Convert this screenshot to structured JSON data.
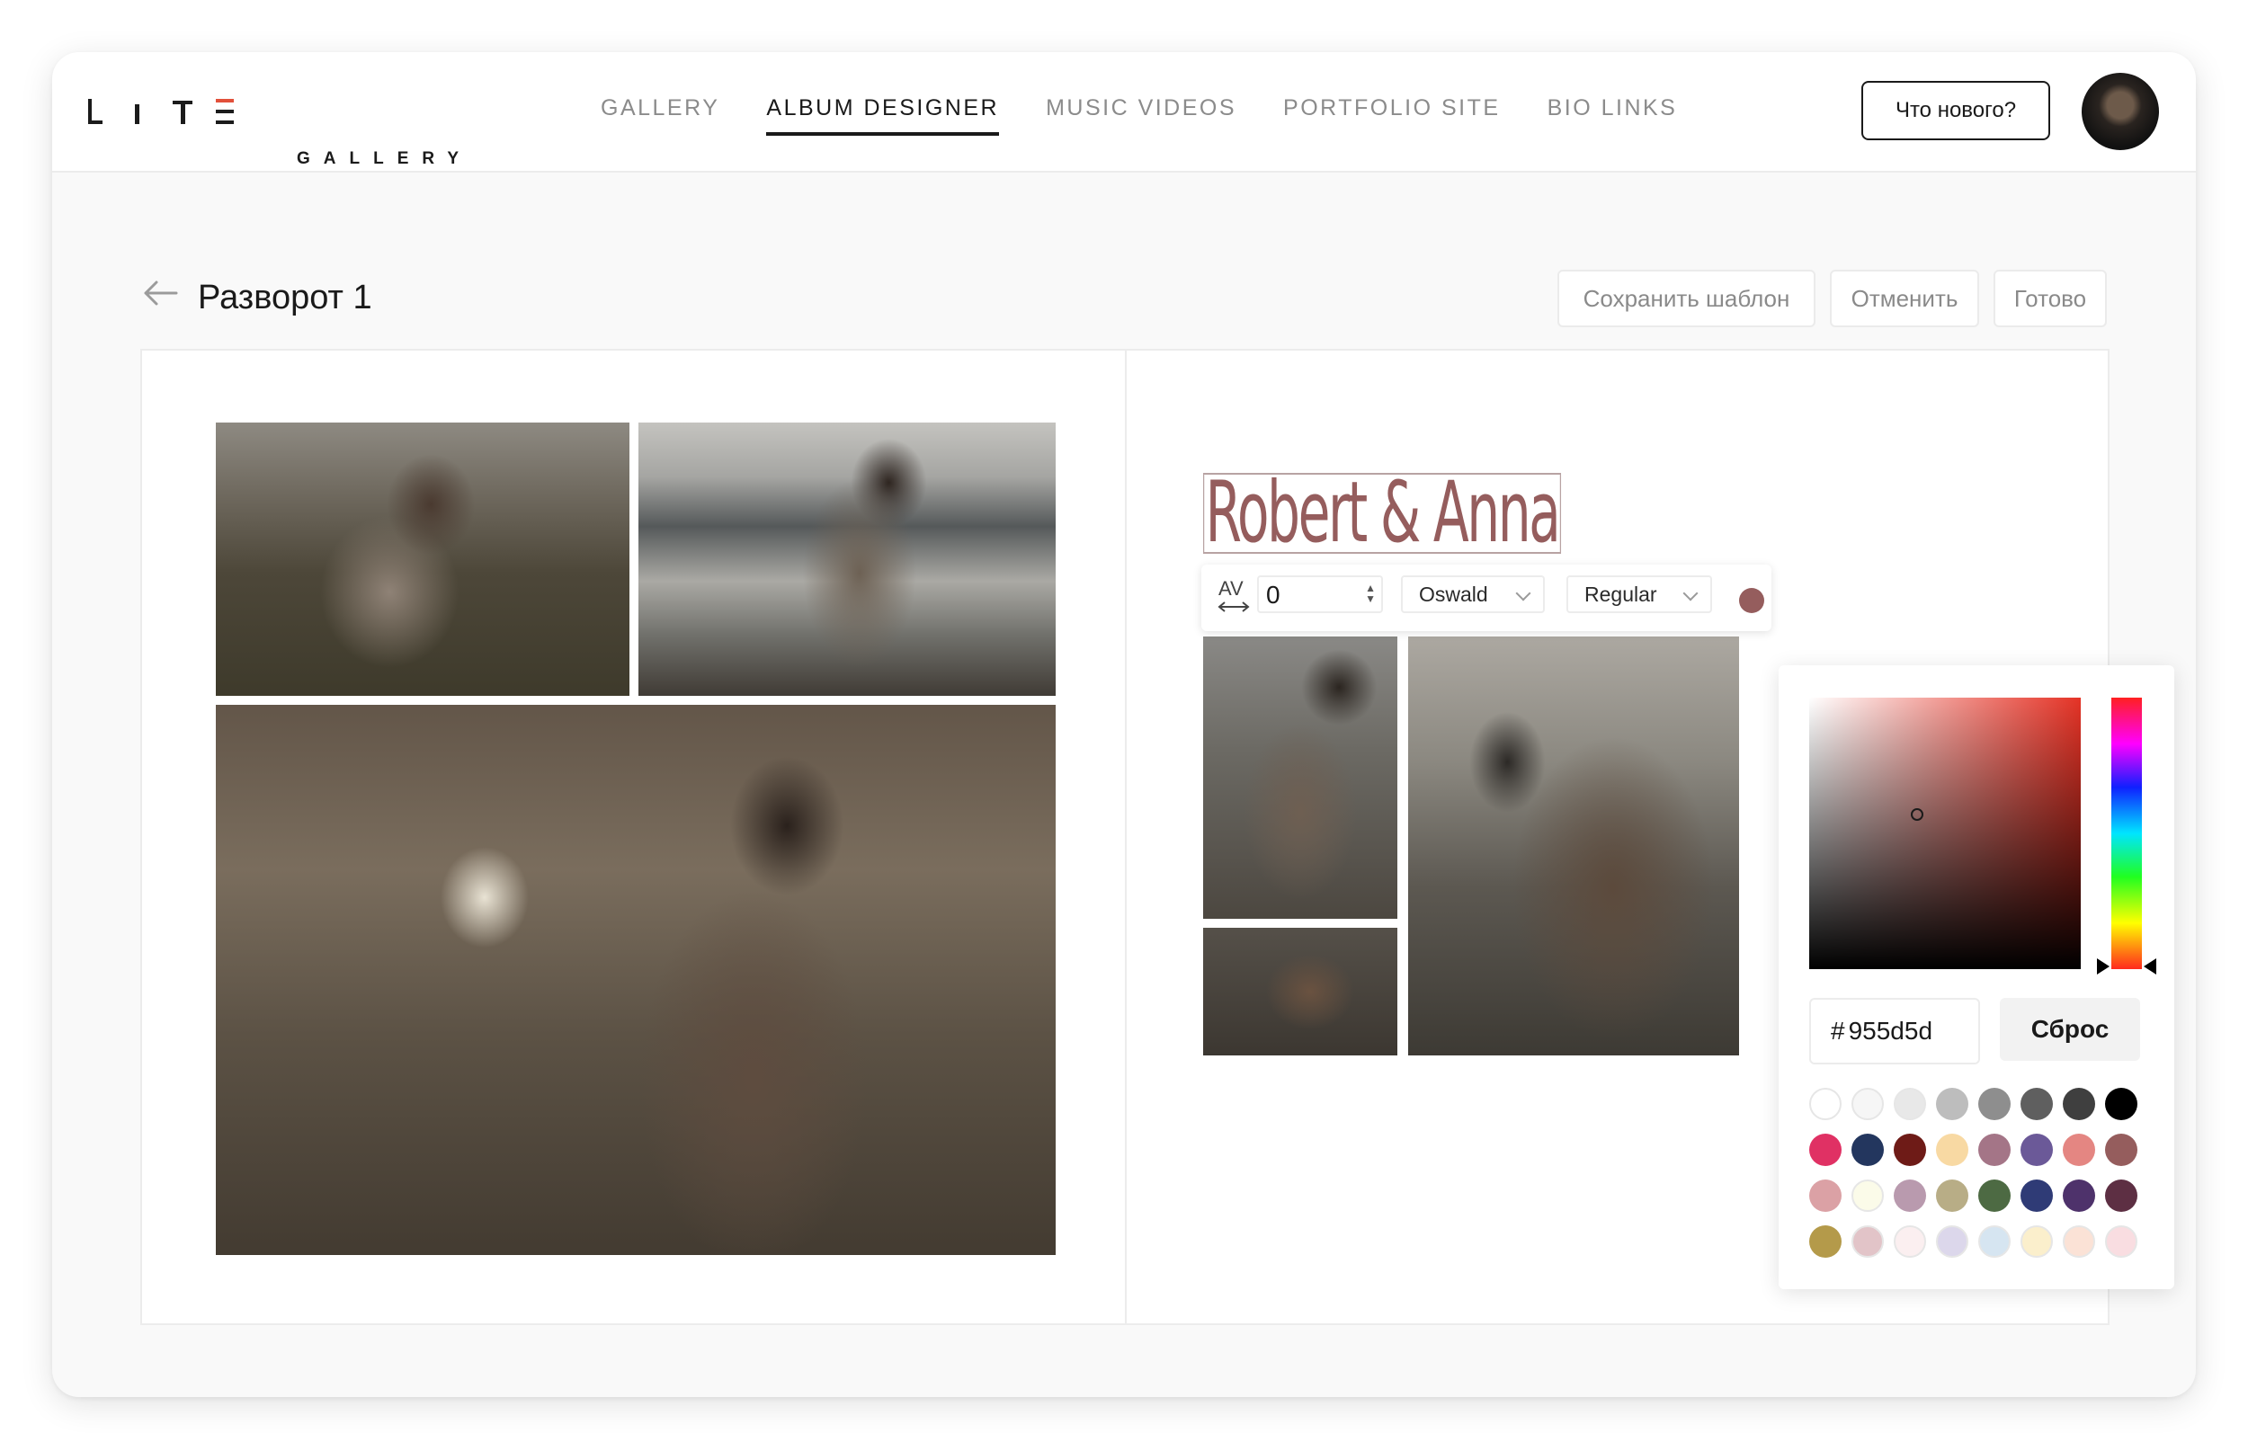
{
  "brand": {
    "wordmark": "GALLERY",
    "logo_letters": "LITE"
  },
  "nav": [
    {
      "label": "GALLERY",
      "active": false
    },
    {
      "label": "ALBUM DESIGNER",
      "active": true
    },
    {
      "label": "MUSIC VIDEOS",
      "active": false
    },
    {
      "label": "PORTFOLIO SITE",
      "active": false
    },
    {
      "label": "BIO LINKS",
      "active": false
    }
  ],
  "header": {
    "news_button": "Что нового?"
  },
  "toolbar": {
    "title": "Разворот 1",
    "save_template": "Сохранить шаблон",
    "cancel": "Отменить",
    "done": "Готово"
  },
  "editor": {
    "headline": "Robert & Anna",
    "text_toolbar": {
      "tracking_icon_label": "AV",
      "tracking_value": "0",
      "font_family": "Oswald",
      "font_weight": "Regular",
      "text_color": "#955d5d"
    }
  },
  "color_picker": {
    "hex_prefix": "#",
    "hex_value": "955d5d",
    "reset_label": "Сброс",
    "hue_color": "#e53326",
    "swatches": [
      [
        "#ffffff",
        "#f6f6f6",
        "#e8e8e8",
        "#bdbdbd",
        "#8e8e8e",
        "#5f5f5f",
        "#3f3f3f",
        "#000000"
      ],
      [
        "#e03164",
        "#23365e",
        "#6e1b17",
        "#f8d9a3",
        "#a47587",
        "#6b5998",
        "#e48682",
        "#955d5d"
      ],
      [
        "#dba1a5",
        "#fbfbe9",
        "#b99aae",
        "#b8ad86",
        "#4d6a43",
        "#2f3b76",
        "#4e326b",
        "#5d2f43"
      ],
      [
        "#b49a4a",
        "#e2c4c8",
        "#fbeff0",
        "#dcd7eb",
        "#d6e5f1",
        "#fbefcc",
        "#fbe2d6",
        "#f9dde1"
      ]
    ]
  },
  "colors": {
    "accent": "#955d5d",
    "active_nav": "#1a1a1a",
    "muted_text": "#8a8a8a"
  }
}
